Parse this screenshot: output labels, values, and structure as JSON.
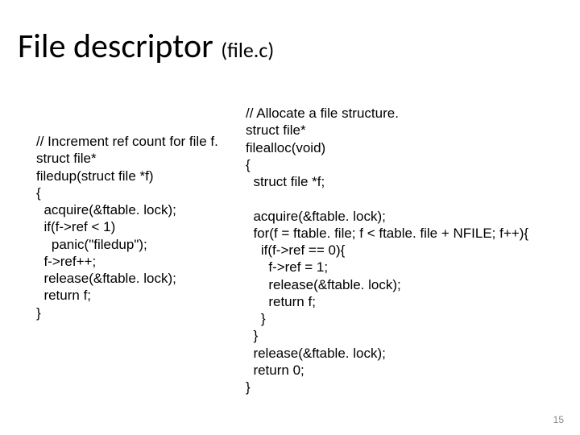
{
  "title": {
    "main": "File descriptor ",
    "paren": "(file.c)"
  },
  "codeLeft": "// Increment ref count for file f.\nstruct file*\nfiledup(struct file *f)\n{\n  acquire(&ftable. lock);\n  if(f->ref < 1)\n    panic(\"filedup\");\n  f->ref++;\n  release(&ftable. lock);\n  return f;\n}",
  "codeRight": "// Allocate a file structure.\nstruct file*\nfilealloc(void)\n{\n  struct file *f;\n\n  acquire(&ftable. lock);\n  for(f = ftable. file; f < ftable. file + NFILE; f++){\n    if(f->ref == 0){\n      f->ref = 1;\n      release(&ftable. lock);\n      return f;\n    }\n  }\n  release(&ftable. lock);\n  return 0;\n}",
  "pageNumber": "15"
}
